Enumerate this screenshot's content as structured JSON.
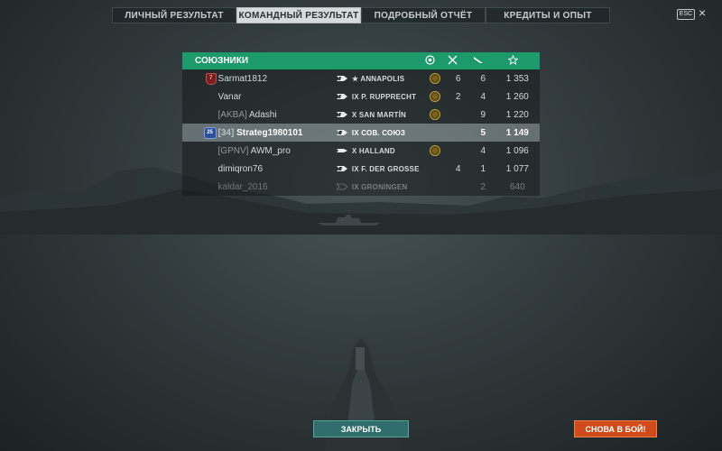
{
  "tabs": [
    {
      "label": "ЛИЧНЫЙ РЕЗУЛЬТАТ",
      "active": false
    },
    {
      "label": "КОМАНДНЫЙ РЕЗУЛЬТАТ",
      "active": true
    },
    {
      "label": "ПОДРОБНЫЙ ОТЧЁТ",
      "active": false
    },
    {
      "label": "КРЕДИТЫ И ОПЫТ",
      "active": false
    }
  ],
  "esc_label": "ESC",
  "close_glyph": "×",
  "team": {
    "title": "СОЮЗНИКИ",
    "columns": [
      "medal-icon",
      "plane-icon",
      "ship-sunk-icon",
      "star-icon"
    ],
    "rows": [
      {
        "badge": "rank",
        "badge_text": "7",
        "clan": "",
        "name": "Sarmat1812",
        "ship": "★ ANNAPOLIS",
        "medal": true,
        "a": "6",
        "b": "6",
        "exp": "1 353",
        "style": ""
      },
      {
        "badge": "",
        "badge_text": "",
        "clan": "",
        "name": "Vanar",
        "ship": "IX P. RUPPRECHT",
        "medal": true,
        "a": "2",
        "b": "4",
        "exp": "1 260",
        "style": ""
      },
      {
        "badge": "",
        "badge_text": "",
        "clan": "[AKBA]",
        "name": "Adashi",
        "ship": "X SAN MARTÍN",
        "medal": true,
        "a": "",
        "b": "9",
        "exp": "1 220",
        "style": ""
      },
      {
        "badge": "level",
        "badge_text": "25",
        "clan": "[34]",
        "name": "Strateg1980101",
        "ship": "IX СОВ. СОЮЗ",
        "medal": false,
        "a": "",
        "b": "5",
        "exp": "1 149",
        "style": "self"
      },
      {
        "badge": "",
        "badge_text": "",
        "clan": "[GPNV]",
        "name": "AWM_pro",
        "ship": "X HALLAND",
        "medal": true,
        "a": "",
        "b": "4",
        "exp": "1 096",
        "style": ""
      },
      {
        "badge": "",
        "badge_text": "",
        "clan": "",
        "name": "dimiqron76",
        "ship": "IX F. DER GROSSE",
        "medal": false,
        "a": "4",
        "b": "1",
        "exp": "1 077",
        "style": ""
      },
      {
        "badge": "",
        "badge_text": "",
        "clan": "",
        "name": "kaldar_2016",
        "ship": "IX GRONINGEN",
        "medal": false,
        "a": "",
        "b": "2",
        "exp": "640",
        "style": "dim"
      }
    ]
  },
  "buttons": {
    "close": "ЗАКРЫТЬ",
    "battle": "СНОВА В БОЙ!"
  },
  "colors": {
    "header": "#1d9a6b",
    "battle_button": "#d14a1a",
    "close_button": "#2f6e6a"
  }
}
